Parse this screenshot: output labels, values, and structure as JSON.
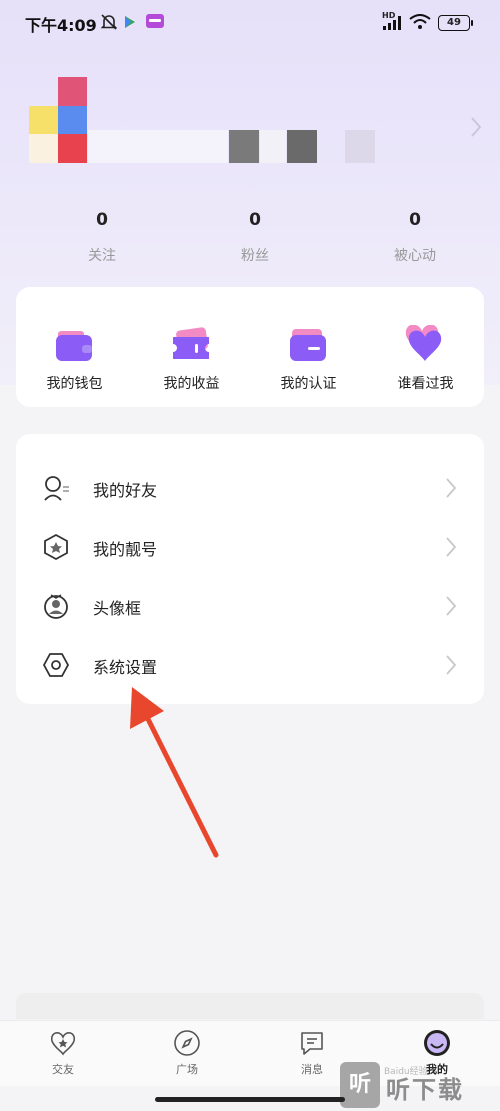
{
  "status_bar": {
    "time": "下午4:09",
    "battery": "49",
    "network": "HD"
  },
  "profile": {
    "stats": [
      {
        "value": "0",
        "label": "关注"
      },
      {
        "value": "0",
        "label": "粉丝"
      },
      {
        "value": "0",
        "label": "被心动"
      }
    ]
  },
  "quick_actions": [
    {
      "label": "我的钱包",
      "icon": "wallet-icon"
    },
    {
      "label": "我的收益",
      "icon": "ticket-icon"
    },
    {
      "label": "我的认证",
      "icon": "id-card-icon"
    },
    {
      "label": "谁看过我",
      "icon": "heart-icon"
    }
  ],
  "menu": [
    {
      "label": "我的好友",
      "icon": "friends-icon"
    },
    {
      "label": "我的靓号",
      "icon": "badge-icon"
    },
    {
      "label": "头像框",
      "icon": "avatar-frame-icon"
    },
    {
      "label": "系统设置",
      "icon": "settings-icon"
    }
  ],
  "tabbar": [
    {
      "label": "交友",
      "icon": "heart-star-icon"
    },
    {
      "label": "广场",
      "icon": "compass-icon"
    },
    {
      "label": "消息",
      "icon": "message-icon"
    },
    {
      "label": "我的",
      "icon": "profile-face-icon",
      "active": true
    }
  ],
  "watermark": {
    "logo": "听",
    "text": "听下载",
    "small": "Baidu经验"
  },
  "colors": {
    "accent": "#8b5cf6",
    "arrow": "#e8472e",
    "hero_bg": "#e6e0f9"
  }
}
